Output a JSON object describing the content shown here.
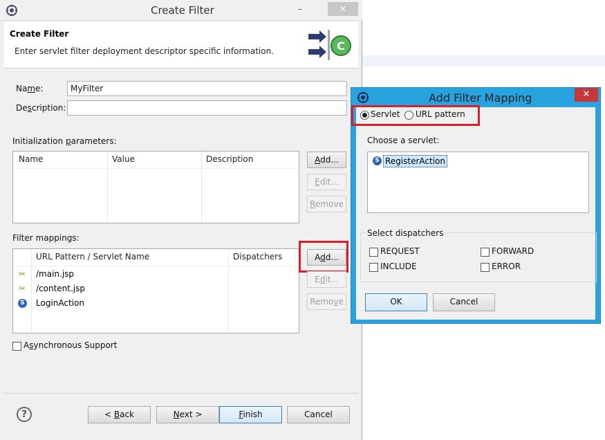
{
  "window": {
    "title": "Create Filter",
    "minimize": "–",
    "close": "✕"
  },
  "banner": {
    "title": "Create Filter",
    "subtitle": "Enter servlet filter deployment descriptor specific information."
  },
  "form": {
    "name_label_pre": "Na",
    "name_label_u": "m",
    "name_label_post": "e:",
    "name_value": "MyFilter",
    "desc_label_pre": "De",
    "desc_label_u": "s",
    "desc_label_post": "cription:",
    "desc_value": ""
  },
  "init_params": {
    "label_pre": "Initialization ",
    "label_u": "p",
    "label_post": "arameters:",
    "columns": [
      "Name",
      "Value",
      "Description"
    ],
    "add_pre": "",
    "add_u": "A",
    "add_post": "dd...",
    "edit_pre": "",
    "edit_u": "E",
    "edit_post": "dit...",
    "remove_pre": "",
    "remove_u": "R",
    "remove_post": "emove"
  },
  "filter_mappings": {
    "label": "Filter mappings:",
    "columns": [
      "URL Pattern / Servlet Name",
      "Dispatchers"
    ],
    "rows": [
      {
        "icon": "url-pattern-icon",
        "name": "/main.jsp",
        "dispatchers": ""
      },
      {
        "icon": "url-pattern-icon",
        "name": "/content.jsp",
        "dispatchers": ""
      },
      {
        "icon": "servlet-icon",
        "name": "LoginAction",
        "dispatchers": ""
      }
    ],
    "add_pre": "A",
    "add_u": "d",
    "add_post": "d...",
    "edit_pre": "E",
    "edit_u": "d",
    "edit_post": "it...",
    "remove_pre": "Remo",
    "remove_u": "v",
    "remove_post": "e"
  },
  "async": {
    "label_pre": "A",
    "label_u": "s",
    "label_post": "ynchronous Support",
    "checked": false
  },
  "footer": {
    "help": "?",
    "back_pre": "< ",
    "back_u": "B",
    "back_post": "ack",
    "next_pre": "",
    "next_u": "N",
    "next_post": "ext >",
    "finish_pre": "",
    "finish_u": "F",
    "finish_post": "inish",
    "cancel": "Cancel"
  },
  "dialog": {
    "title": "Add Filter Mapping",
    "close": "✕",
    "radio_servlet": "Servlet",
    "radio_url": "URL pattern",
    "selected_radio": "Servlet",
    "choose_label": "Choose a servlet:",
    "servlets": [
      {
        "icon": "servlet-icon",
        "name": "RegisterAction"
      }
    ],
    "dispatchers_label": "Select dispatchers",
    "dispatchers": [
      "REQUEST",
      "FORWARD",
      "INCLUDE",
      "ERROR"
    ],
    "ok": "OK",
    "cancel": "Cancel"
  },
  "colors": {
    "dialog_frame": "#29a3e0",
    "highlight": "#d6202a",
    "servlet_icon": "#2a67b1"
  }
}
